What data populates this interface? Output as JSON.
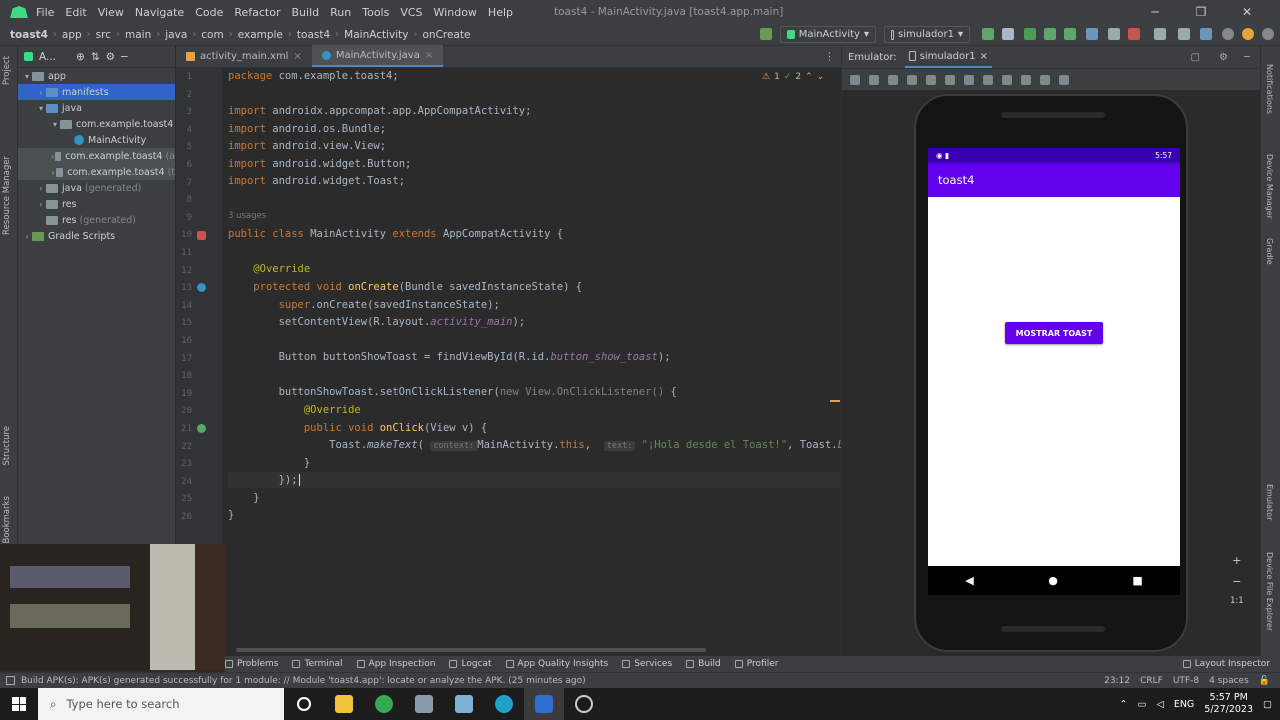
{
  "menubar": {
    "items": [
      "File",
      "Edit",
      "View",
      "Navigate",
      "Code",
      "Refactor",
      "Build",
      "Run",
      "Tools",
      "VCS",
      "Window",
      "Help"
    ],
    "window_title": "toast4 - MainActivity.java [toast4.app.main]"
  },
  "breadcrumb": [
    "toast4",
    "app",
    "src",
    "main",
    "java",
    "com",
    "example",
    "toast4",
    "MainActivity",
    "onCreate"
  ],
  "toolbar": {
    "run_config": "MainActivity",
    "device": "simulador1"
  },
  "project": {
    "header": "A...",
    "tree": [
      {
        "label": "app",
        "indent": 0,
        "arrow": "▾",
        "icon": "folder",
        "state": "normal"
      },
      {
        "label": "manifests",
        "indent": 1,
        "arrow": "›",
        "icon": "folder-blue",
        "state": "selected"
      },
      {
        "label": "java",
        "indent": 1,
        "arrow": "▾",
        "icon": "folder-blue",
        "state": "normal"
      },
      {
        "label": "com.example.toast4",
        "indent": 2,
        "arrow": "▾",
        "icon": "folder",
        "state": "normal"
      },
      {
        "label": "MainActivity",
        "indent": 3,
        "arrow": "",
        "icon": "class",
        "state": "normal"
      },
      {
        "label": "com.example.toast4",
        "suffix": "(a",
        "indent": 2,
        "arrow": "›",
        "icon": "folder",
        "state": "highlight"
      },
      {
        "label": "com.example.toast4",
        "suffix": "(t",
        "indent": 2,
        "arrow": "›",
        "icon": "folder",
        "state": "highlight"
      },
      {
        "label": "java",
        "suffix": "(generated)",
        "indent": 1,
        "arrow": "›",
        "icon": "folder",
        "state": "normal"
      },
      {
        "label": "res",
        "indent": 1,
        "arrow": "›",
        "icon": "folder",
        "state": "normal"
      },
      {
        "label": "res",
        "suffix": "(generated)",
        "indent": 1,
        "arrow": "",
        "icon": "folder",
        "state": "normal"
      },
      {
        "label": "Gradle Scripts",
        "indent": 0,
        "arrow": "›",
        "icon": "gradle",
        "state": "normal"
      }
    ]
  },
  "left_strip": [
    "Project",
    "Resource Manager",
    "Structure",
    "Bookmarks"
  ],
  "editor": {
    "tabs": [
      "activity_main.xml",
      "MainActivity.java"
    ],
    "active_tab": "MainActivity.java",
    "inspection": {
      "warnings": "1",
      "ok": "2"
    },
    "usages": "3 usages",
    "line_numbers": [
      "1",
      "2",
      "3",
      "4",
      "5",
      "6",
      "7",
      "8",
      "9",
      "10",
      "11",
      "12",
      "13",
      "14",
      "15",
      "16",
      "17",
      "18",
      "19",
      "20",
      "21",
      "22",
      "23",
      "24",
      "25",
      "26"
    ]
  },
  "emulator": {
    "label": "Emulator:",
    "tab": "simulador1",
    "status_time": "5:57",
    "app_title": "toast4",
    "button_label": "MOSTRAR TOAST"
  },
  "right_strip": [
    "Notifications",
    "Device Manager",
    "Gradle",
    "Emulator",
    "Device File Explorer"
  ],
  "emulator_zoom": [
    "+",
    "−",
    "1:1"
  ],
  "bottom_tools": [
    "Problems",
    "Terminal",
    "App Inspection",
    "Logcat",
    "App Quality Insights",
    "Services",
    "Build",
    "Profiler",
    "Layout Inspector"
  ],
  "status": {
    "message": "Build APK(s): APK(s) generated successfully for 1 module: // Module 'toast4.app': locate or analyze the APK. (25 minutes ago)",
    "position": "23:12",
    "line_sep": "CRLF",
    "encoding": "UTF-8",
    "indent": "4 spaces"
  },
  "taskbar": {
    "search_placeholder": "Type here to search",
    "lang": "ENG",
    "time": "5:57 PM",
    "date": "5/27/2023"
  },
  "colors": {
    "accent": "#6200ee",
    "status_bar": "#3700b3",
    "selection": "#2f65ca",
    "android_green": "#3ddc84"
  }
}
